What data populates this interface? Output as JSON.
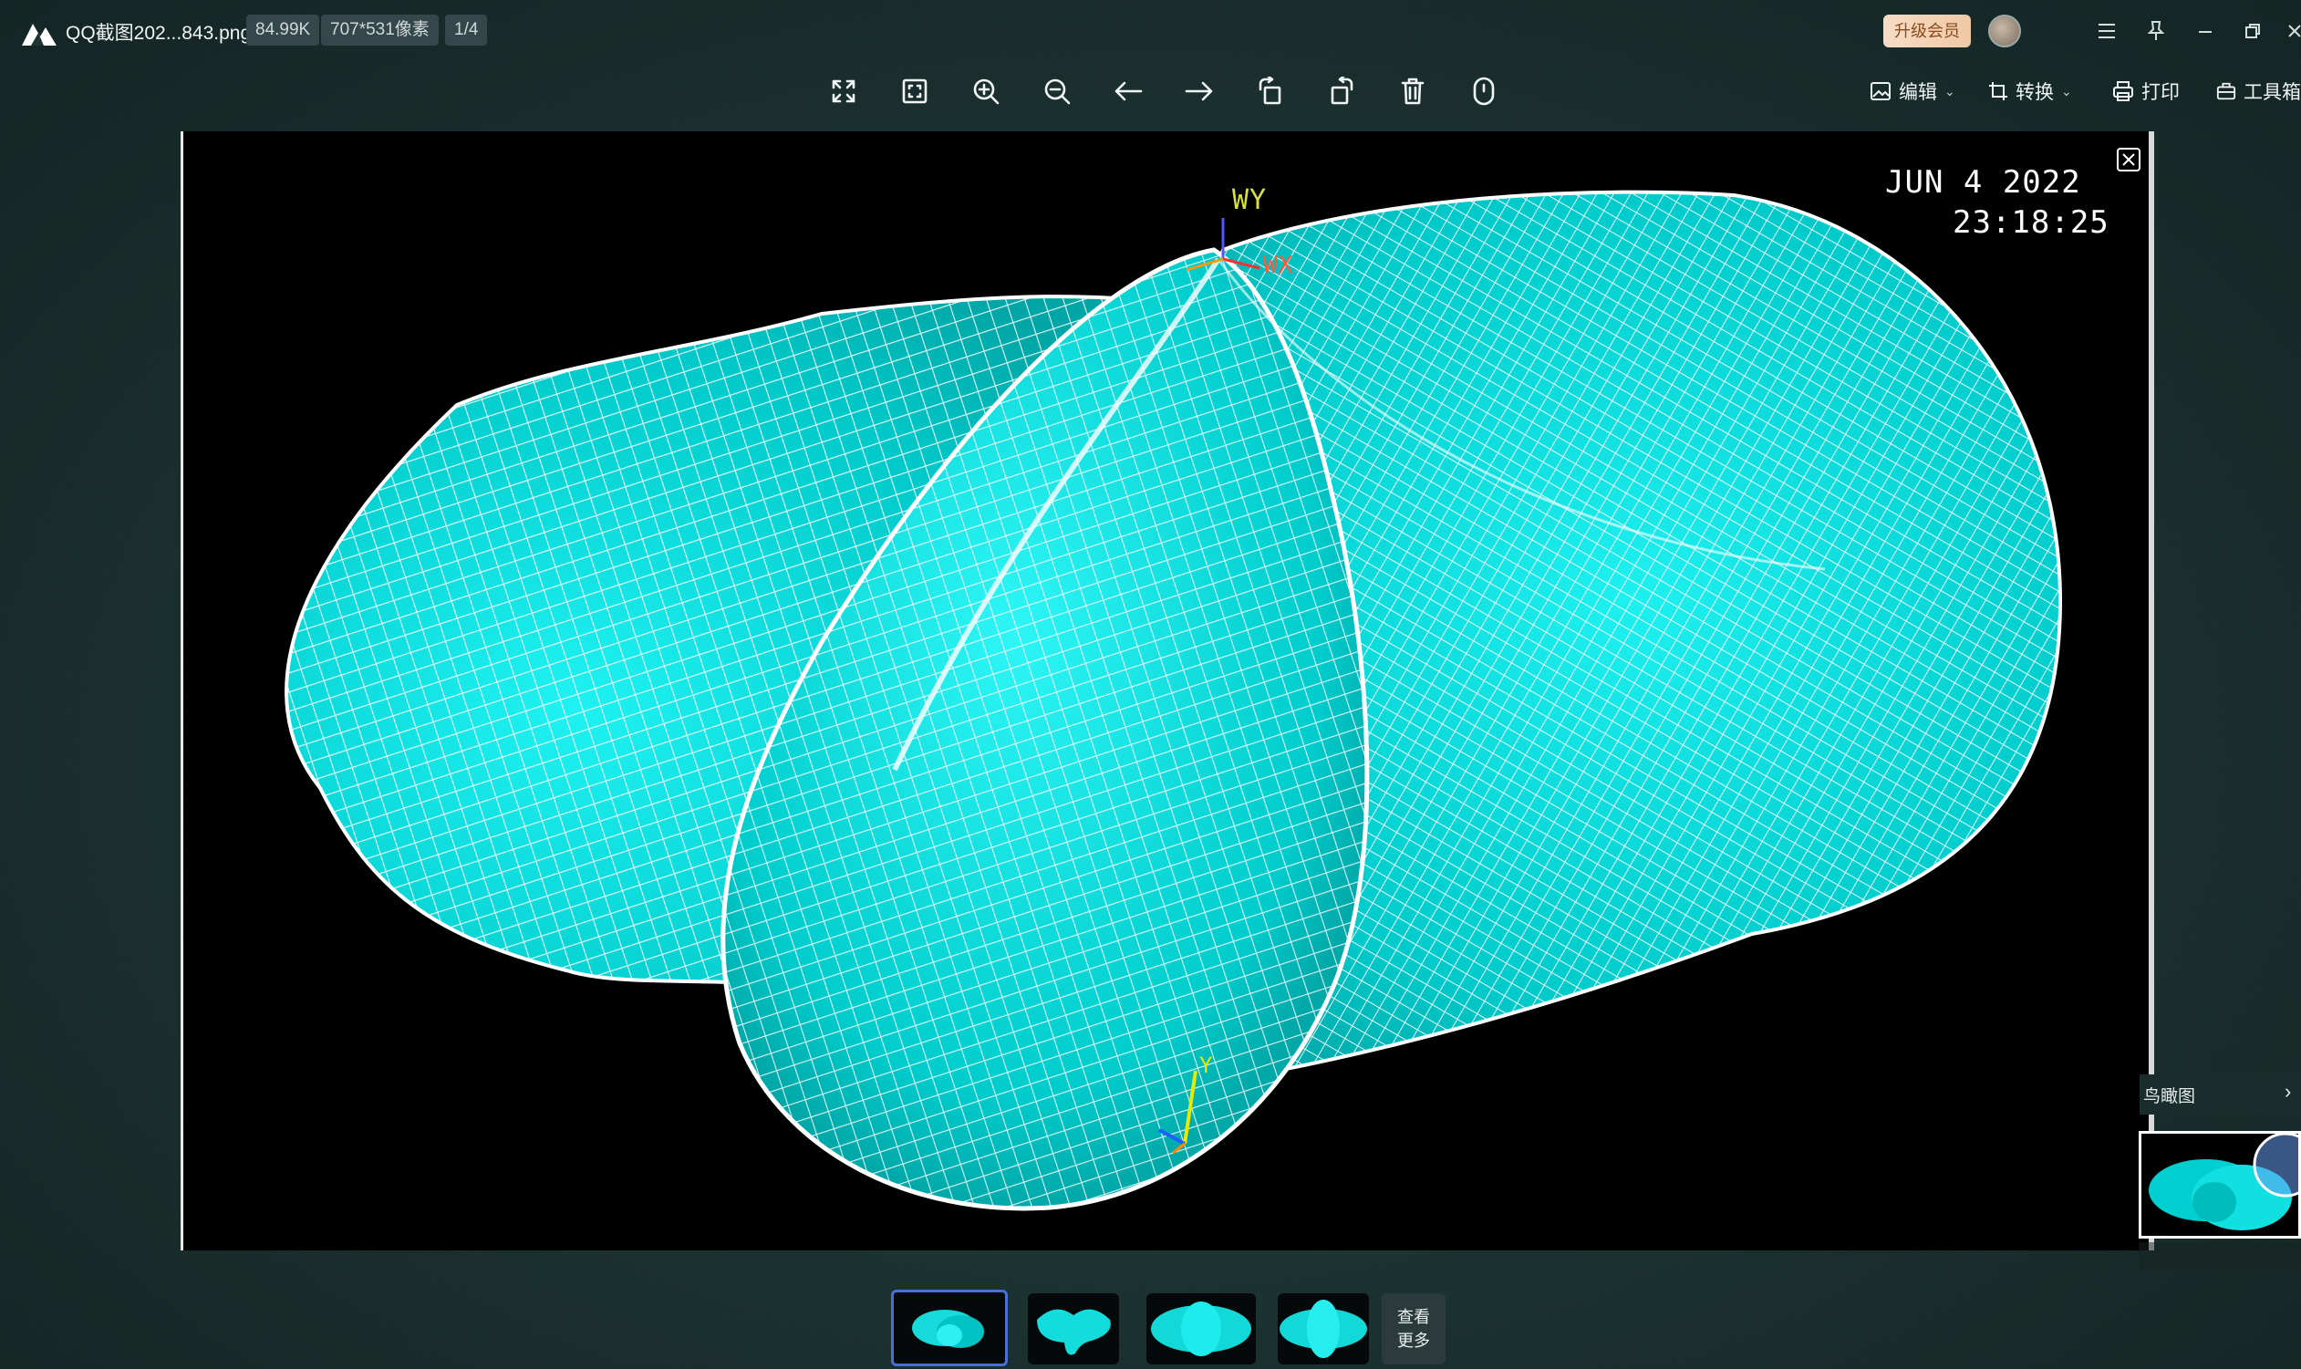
{
  "titlebar": {
    "filename": "QQ截图202...843.png",
    "filesize": "84.99K",
    "dimensions": "707*531像素",
    "page_counter": "1/4",
    "upgrade_label": "升级会员"
  },
  "toolbar": {
    "icons": [
      "fullscreen-icon",
      "fit-window-icon",
      "zoom-in-icon",
      "zoom-out-icon",
      "previous-icon",
      "next-icon",
      "rotate-left-icon",
      "rotate-right-icon",
      "delete-icon",
      "info-icon"
    ],
    "edit_label": "编辑",
    "convert_label": "转换",
    "print_label": "打印",
    "tools_label": "工具箱"
  },
  "viewer": {
    "date_text": "JUN  4 2022",
    "time_text": "23:18:25",
    "axis_wy": "WY",
    "axis_wx": "WX",
    "axis_y": "Y",
    "mesh_color": "#00e0e0"
  },
  "minimap": {
    "title": "鸟瞰图",
    "arrow": "›"
  },
  "thumbnails": {
    "count": 4,
    "more_line1": "查看",
    "more_line2": "更多"
  }
}
